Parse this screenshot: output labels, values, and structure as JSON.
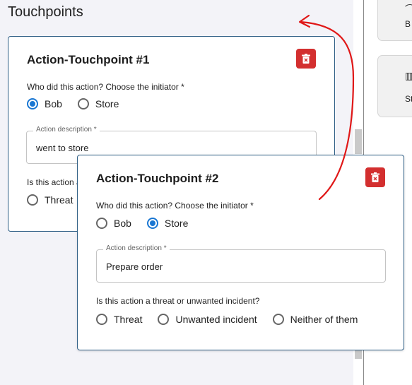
{
  "page": {
    "title": "Touchpoints"
  },
  "side": {
    "buttons": [
      {
        "label": "B",
        "icon": "tool-icon"
      },
      {
        "label": "St",
        "icon": "bars-icon"
      }
    ]
  },
  "cards": [
    {
      "title": "Action-Touchpoint #1",
      "initiator_question": "Who did this action? Choose the initiator *",
      "initiator_options": [
        "Bob",
        "Store"
      ],
      "initiator_selected": "Bob",
      "description_label": "Action description *",
      "description_value": "went to store",
      "threat_question": "Is this action a threat or unwanted incident?",
      "threat_option_visible": "Threat"
    },
    {
      "title": "Action-Touchpoint #2",
      "initiator_question": "Who did this action? Choose the initiator *",
      "initiator_options": [
        "Bob",
        "Store"
      ],
      "initiator_selected": "Store",
      "description_label": "Action description *",
      "description_value": "Prepare order",
      "threat_question": "Is this action a threat or unwanted incident?",
      "threat_options": [
        "Threat",
        "Unwanted incident",
        "Neither of them"
      ]
    }
  ],
  "colors": {
    "accent": "#1976d2",
    "delete": "#d32f2f",
    "card_border": "#2f5f86",
    "annotation": "#e01818"
  }
}
